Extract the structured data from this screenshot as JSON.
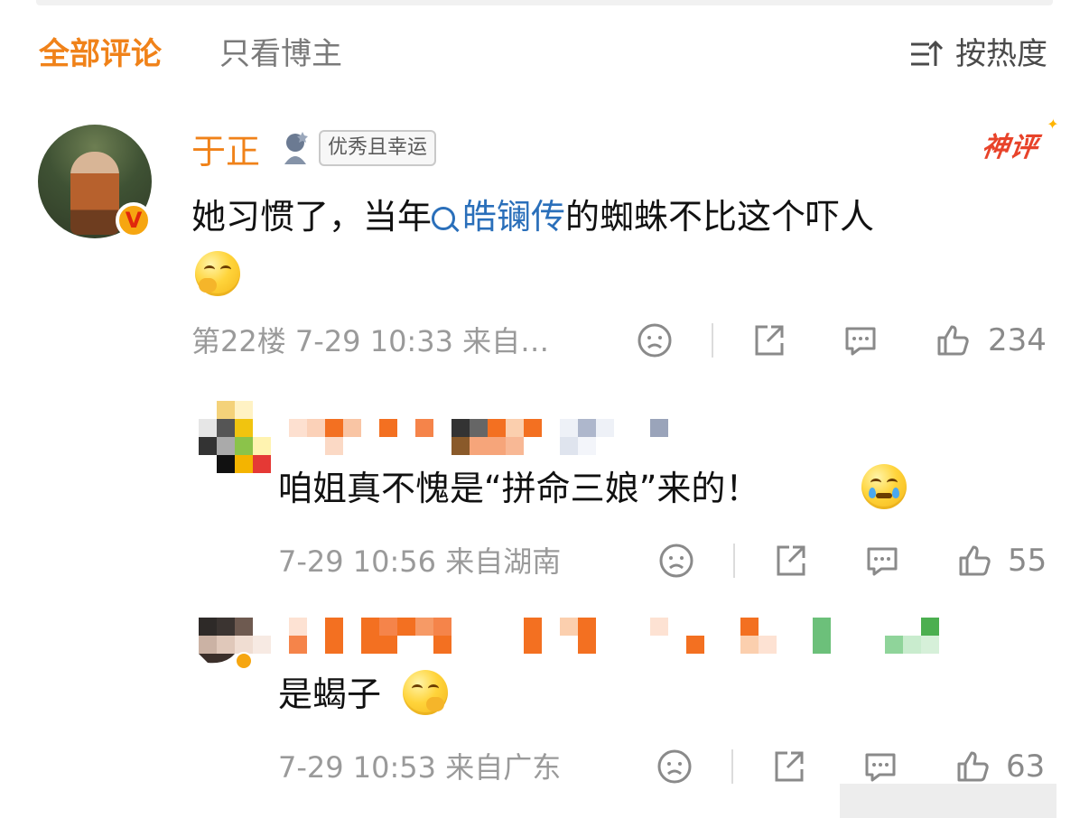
{
  "tabs": {
    "all": "全部评论",
    "author_only": "只看博主"
  },
  "sort": {
    "label": "按热度"
  },
  "colors": {
    "accent": "#f08219",
    "link": "#2a6fba",
    "shenping": "#e8432a"
  },
  "comment": {
    "username": "于正",
    "medal_label": "优秀且幸运",
    "badge": "神评",
    "verified_badge": "V",
    "text_before": "她习惯了，当年",
    "topic": "皓镧传",
    "text_after": "的蜘蛛不比这个吓人",
    "floor": "第22楼",
    "datetime": "7-29 10:33",
    "location": "来自…",
    "likes": "234",
    "icons": [
      "dislike-icon",
      "share-icon",
      "reply-icon",
      "like-icon"
    ]
  },
  "replies": [
    {
      "text": "咱姐真不愧是“拼命三娘”来的！",
      "datetime": "7-29 10:56",
      "location": "来自湖南",
      "likes": "55"
    },
    {
      "text": "是蝎子",
      "datetime": "7-29 10:53",
      "location": "来自广东",
      "likes": "63"
    }
  ]
}
